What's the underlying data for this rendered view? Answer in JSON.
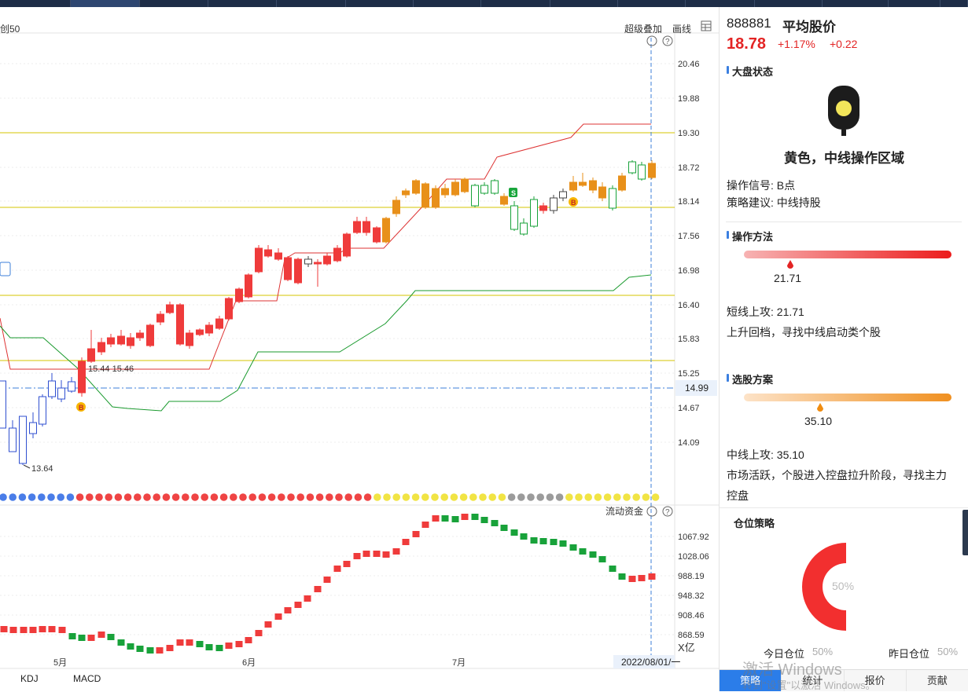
{
  "chart_header": {
    "left_label": "创50",
    "super_overlay": "超级叠加",
    "draw_line": "画线",
    "flow_label": "流动资金"
  },
  "chart_data": {
    "type": "candlestick",
    "price_axis": [
      "20.46",
      "19.88",
      "19.30",
      "18.72",
      "18.14",
      "17.56",
      "16.98",
      "16.40",
      "15.83",
      "15.25",
      "14.67",
      "14.09"
    ],
    "current_price_label": "14.99",
    "annotations": {
      "low_label": "13.64",
      "pair_label": "15.44  15.46",
      "signal_b": "B",
      "signal_s": "S"
    },
    "flow_axis": [
      "1067.92",
      "1028.06",
      "988.19",
      "948.32",
      "908.46",
      "868.59"
    ],
    "flow_unit": "X亿",
    "x_axis": [
      "5月",
      "6月",
      "7月"
    ],
    "date_label": "2022/08/01/一",
    "indicators": [
      "KDJ",
      "MACD"
    ]
  },
  "sidebar": {
    "code": "888881",
    "name": "平均股价",
    "price": "18.78",
    "pct": "+1.17%",
    "change": "+0.22",
    "market_title": "大盘状态",
    "light_text": "黄色，中线操作区域",
    "signal_line": "操作信号: B点",
    "advice_line": "策略建议: 中线持股",
    "method_title": "操作方法",
    "method_value": "21.71",
    "short_attack": "短线上攻:  21.71",
    "short_desc": "上升回档，寻找中线启动类个股",
    "select_title": "选股方案",
    "select_value": "35.10",
    "mid_attack": "中线上攻:  35.10",
    "mid_desc_1": "市场活跃，个股进入控盘拉升阶段，寻找主力",
    "mid_desc_2": "控盘",
    "position_title": "仓位策略",
    "pie_pct": "50%",
    "today_label": "今日仓位",
    "today_pct": "50%",
    "yesterday_label": "昨日仓位",
    "yesterday_pct": "50%",
    "tabs": [
      "策略",
      "统计",
      "报价",
      "贡献"
    ]
  },
  "watermark": {
    "line1": "激活 Windows",
    "line2": "转到\"设置\"以激活 Windows。"
  },
  "colors": {
    "up": "#ef3b3b",
    "down": "#18a23a",
    "orange": "#e8901a",
    "blue": "#2f4fd0",
    "accent": "#2b7de9"
  }
}
